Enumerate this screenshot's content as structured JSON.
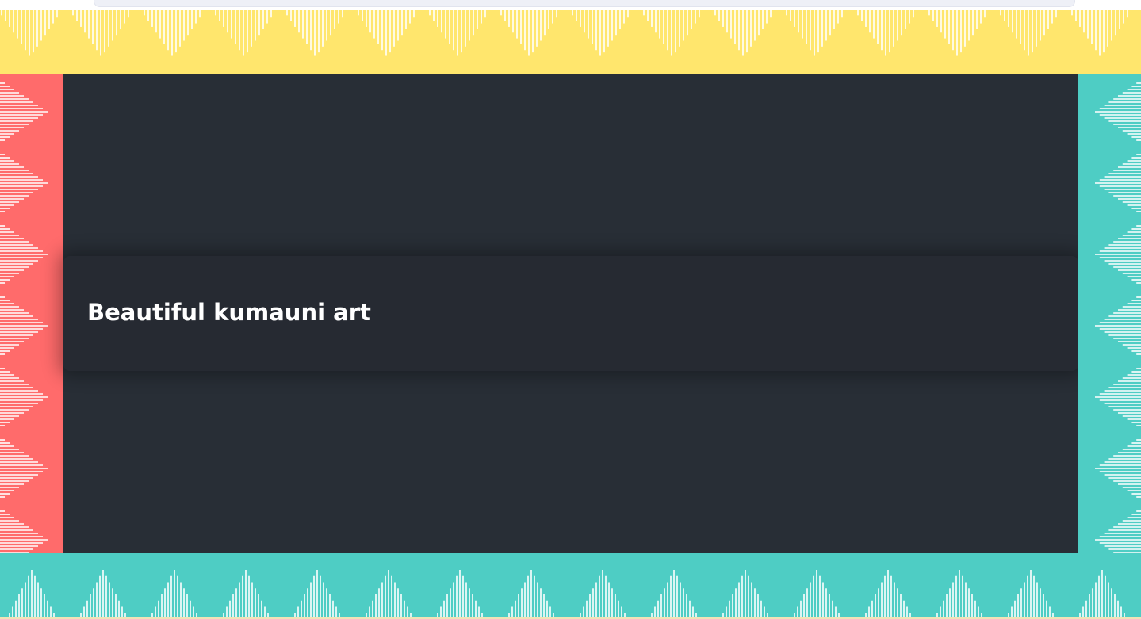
{
  "card": {
    "title": "Beautiful kumauni art"
  },
  "colors": {
    "top_border": "#ffe66d",
    "left_border": "#ff6b6b",
    "right_border": "#4ecdc4",
    "bottom_border": "#4ecdc4",
    "stage_background": "#282e36",
    "card_background": "#262a32",
    "title_text": "#ffffff",
    "pattern_lines": "#ffffff"
  },
  "icons": {
    "pattern": "aipan-stripe-triangle-pattern"
  }
}
